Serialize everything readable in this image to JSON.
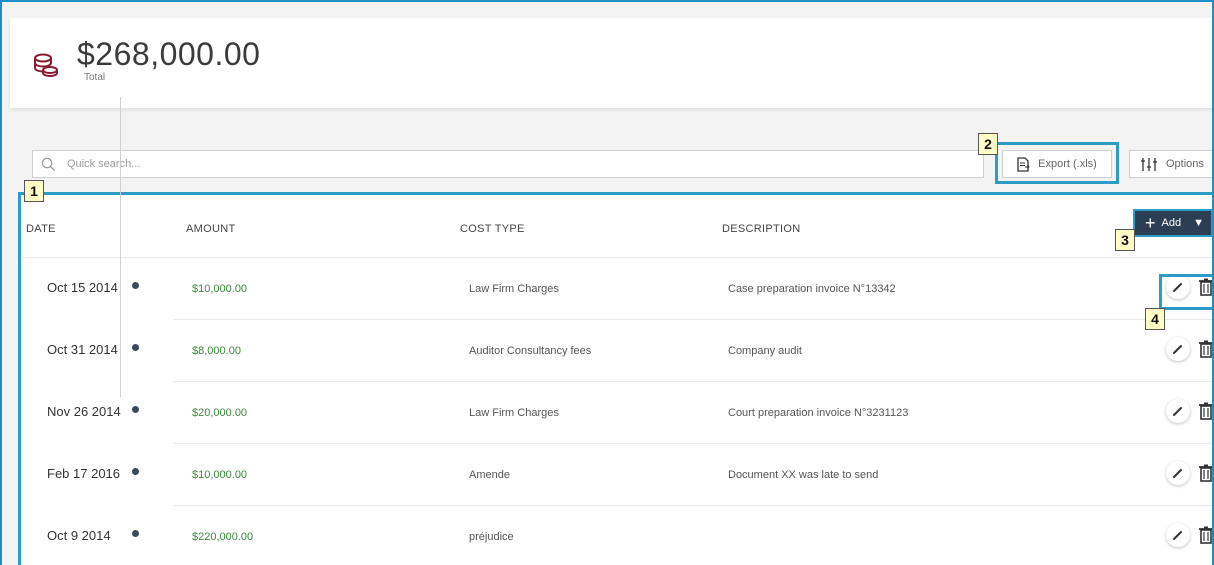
{
  "summary": {
    "total_value": "$268,000.00",
    "total_label": "Total",
    "icon": "coins-icon",
    "icon_color": "#8b1a2e"
  },
  "toolbar": {
    "search_placeholder": "Quick search...",
    "export_label": "Export (.xls)",
    "options_label": "Options",
    "add_label": "Add"
  },
  "table": {
    "headers": [
      "DATE",
      "AMOUNT",
      "COST TYPE",
      "DESCRIPTION"
    ],
    "rows": [
      {
        "date": "Oct 15 2014",
        "amount": "$10,000.00",
        "cost_type": "Law Firm Charges",
        "description": "Case preparation invoice N°13342"
      },
      {
        "date": "Oct 31 2014",
        "amount": "$8,000.00",
        "cost_type": "Auditor Consultancy fees",
        "description": "Company audit"
      },
      {
        "date": "Nov 26 2014",
        "amount": "$20,000.00",
        "cost_type": "Law Firm Charges",
        "description": "Court preparation invoice N°3231123"
      },
      {
        "date": "Feb 17 2016",
        "amount": "$10,000.00",
        "cost_type": "Amende",
        "description": "Document XX was late to send"
      },
      {
        "date": "Oct 9 2014",
        "amount": "$220,000.00",
        "cost_type": "préjudice",
        "description": ""
      }
    ]
  },
  "callouts": [
    "1",
    "2",
    "3",
    "4"
  ],
  "colors": {
    "accent": "#2c9cc7",
    "amount": "#3d8a3d",
    "add_button": "#2c3e54",
    "callout_bg": "#fffcc8"
  }
}
